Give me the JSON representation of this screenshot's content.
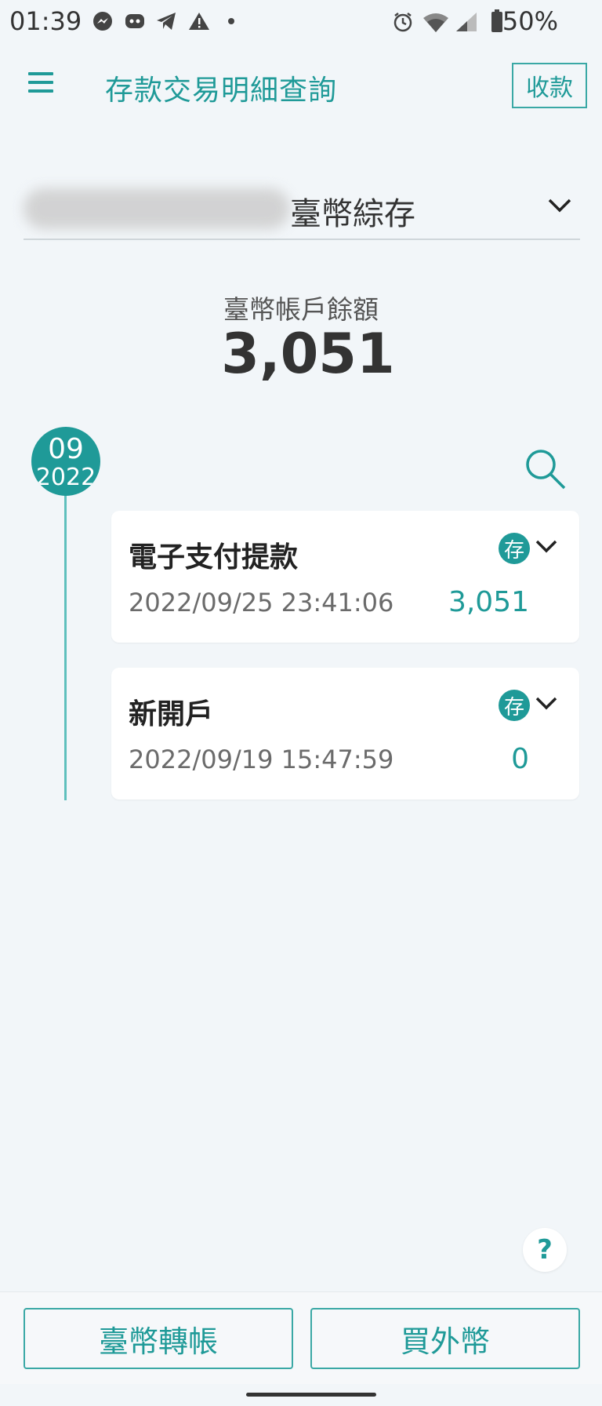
{
  "status_bar": {
    "time": "01:39",
    "battery": "50%",
    "icons": [
      "messenger-icon",
      "discord-icon",
      "telegram-icon",
      "warning-icon",
      "dot-icon",
      "alarm-icon",
      "wifi-icon",
      "signal-icon",
      "battery-icon"
    ]
  },
  "header": {
    "title": "存款交易明細查詢",
    "collect_label": "收款"
  },
  "account": {
    "name": "臺幣綜存"
  },
  "balance": {
    "label": "臺幣帳戶餘額",
    "value": "3,051"
  },
  "timeline": {
    "month": "09",
    "year": "2022"
  },
  "transactions": [
    {
      "title": "電子支付提款",
      "datetime": "2022/09/25 23:41:06",
      "amount": "3,051",
      "badge": "存"
    },
    {
      "title": "新開戶",
      "datetime": "2022/09/19 15:47:59",
      "amount": "0",
      "badge": "存"
    }
  ],
  "help_label": "?",
  "bottom": {
    "transfer_label": "臺幣轉帳",
    "buy_fx_label": "買外幣"
  },
  "colors": {
    "accent": "#1f9a98",
    "background": "#f2f6f9"
  }
}
